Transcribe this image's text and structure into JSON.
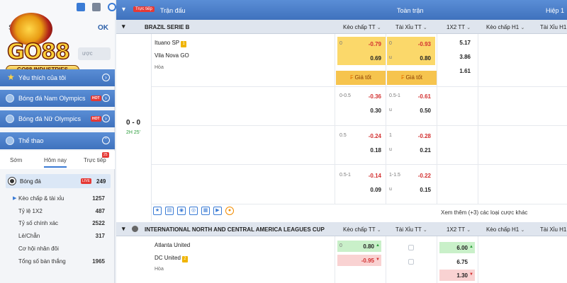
{
  "sidebar": {
    "so_label": "Số",
    "ok_label": "OK",
    "search_placeholder": "ược",
    "logo_text": "GO88",
    "logo_sub": "GO88.INDUSTRIES",
    "items": [
      {
        "label": "Yêu thích của tôi"
      },
      {
        "label": "Bóng đá Nam Olympics",
        "badge": "HOT"
      },
      {
        "label": "Bóng đá Nữ Olympics",
        "badge": "HOT"
      },
      {
        "label": "Thể thao"
      }
    ],
    "tabs": [
      "Sớm",
      "Hôm nay",
      "Trực tiếp"
    ],
    "tab_badge": "25",
    "sport": {
      "label": "Bóng đá",
      "badge": "LIVE",
      "count": "249"
    },
    "sub_items": [
      {
        "label": "Kèo chấp & tài xỉu",
        "count": "1257"
      },
      {
        "label": "Tỷ lệ 1X2",
        "count": "487"
      },
      {
        "label": "Tỷ số chính xác",
        "count": "2522"
      },
      {
        "label": "Lẻ/Chẵn",
        "count": "317"
      },
      {
        "label": "Cơ hội nhân đôi",
        "count": ""
      },
      {
        "label": "Tổng số bàn thắng",
        "count": "1965"
      }
    ]
  },
  "header": {
    "live_pill": "Trực tiếp",
    "col_match": "Trận đấu",
    "col_full": "Toàn trận",
    "col_half": "Hiệp 1"
  },
  "league1": {
    "name": "BRAZIL SERIE B",
    "cols": [
      "Kèo chấp TT",
      "Tài Xỉu TT",
      "1X2 TT",
      "Kèo chấp H1",
      "Tài Xỉu H1"
    ],
    "home": "Ituano SP",
    "home_badge": "1",
    "away": "Vila Nova GO",
    "draw": "Hòa",
    "score": "0 - 0",
    "clock": "2H 25'",
    "rows": [
      {
        "hc_line": "0",
        "hc_home": "-0.79",
        "hc_away": "0.69",
        "ou_line": "0",
        "ou_over": "-0.93",
        "ou_u": "u",
        "ou_under": "0.80"
      },
      {
        "hc_line": "0-0.5",
        "hc_home": "-0.36",
        "hc_away": "0.30",
        "ou_line": "0.5-1",
        "ou_over": "-0.61",
        "ou_u": "u",
        "ou_under": "0.50"
      },
      {
        "hc_line": "0.5",
        "hc_home": "-0.24",
        "hc_away": "0.18",
        "ou_line": "1",
        "ou_over": "-0.28",
        "ou_u": "u",
        "ou_under": "0.21"
      },
      {
        "hc_line": "0.5-1",
        "hc_home": "-0.14",
        "hc_away": "0.09",
        "ou_line": "1-1.5",
        "ou_over": "-0.22",
        "ou_u": "u",
        "ou_under": "0.15"
      }
    ],
    "x12": [
      "5.17",
      "3.86",
      "1.61"
    ],
    "good_price": "Giá tốt",
    "see_more": "Xem thêm (+3) các loại cược khác"
  },
  "league2": {
    "name": "INTERNATIONAL NORTH AND CENTRAL AMERICA LEAGUES CUP",
    "cols": [
      "Kèo chấp TT",
      "Tài Xỉu TT",
      "1X2 TT",
      "Kèo chấp H1",
      "Tài Xỉu H1"
    ],
    "home": "Atlanta United",
    "away": "DC United",
    "away_badge": "2",
    "draw": "Hòa",
    "hc_line": "0",
    "hc_home": "0.80",
    "hc_away": "-0.95",
    "x12": [
      "6.00",
      "6.75",
      "1.30"
    ]
  }
}
